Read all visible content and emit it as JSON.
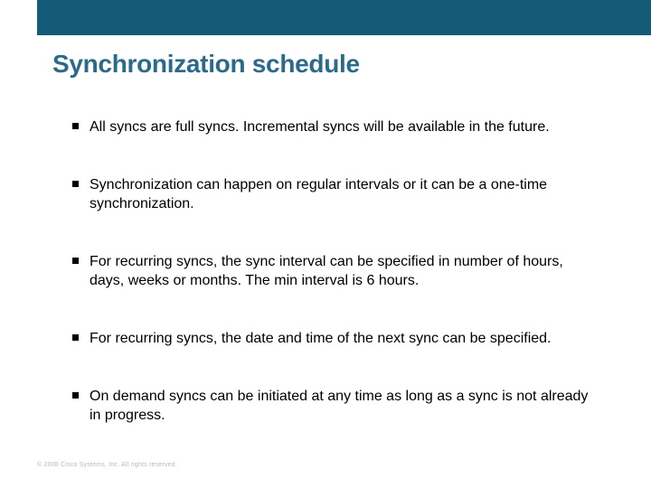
{
  "title": "Synchronization schedule",
  "bullets": [
    "All syncs are full syncs. Incremental syncs will be available in the future.",
    "Synchronization can happen on regular intervals or it can be a one-time synchronization.",
    "For recurring syncs, the sync interval can be specified in number of hours, days, weeks or months. The min interval is 6 hours.",
    "For recurring syncs, the date and time of the next sync can be specified.",
    "On demand syncs can be initiated at any time as long as a sync is not already in progress."
  ],
  "footer": "© 2008 Cisco Systems, Inc. All rights reserved."
}
